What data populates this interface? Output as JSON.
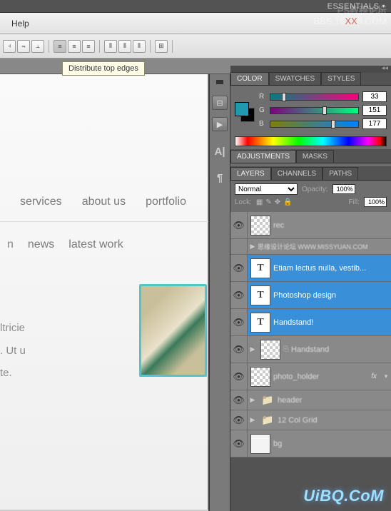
{
  "topbar": {
    "workspace": "ESSENTIALS"
  },
  "watermarks": {
    "w1": "PS教程论坛",
    "w2a": "BBS.16",
    "w2b": "XX",
    "w2c": "8.COM",
    "w3": "UiBQ.CoM"
  },
  "menu": {
    "help": "Help"
  },
  "tooltip": "Distribute top edges",
  "canvas": {
    "nav_main": [
      "services",
      "about us",
      "portfolio"
    ],
    "nav_sub": [
      "n",
      "news",
      "latest work"
    ],
    "hero_lines": [
      "ltricie",
      ". Ut u",
      "te."
    ]
  },
  "color": {
    "tabs": [
      "COLOR",
      "SWATCHES",
      "STYLES"
    ],
    "channels": [
      {
        "label": "R",
        "value": "33",
        "thumb_pct": 13
      },
      {
        "label": "G",
        "value": "151",
        "thumb_pct": 59
      },
      {
        "label": "B",
        "value": "177",
        "thumb_pct": 69
      }
    ]
  },
  "adjustments": {
    "tabs": [
      "ADJUSTMENTS",
      "MASKS"
    ]
  },
  "layers": {
    "tabs": [
      "LAYERS",
      "CHANNELS",
      "PATHS"
    ],
    "blend_mode": "Normal",
    "opacity_label": "Opacity:",
    "opacity": "100%",
    "lock_label": "Lock:",
    "fill_label": "Fill:",
    "fill": "100%",
    "items": [
      {
        "name": "rec",
        "selected": false,
        "type": "checker"
      },
      {
        "name": "思缘设计论坛  WWW.MISSYUAN.COM",
        "selected": false,
        "type": "watermark"
      },
      {
        "name": "Etiam lectus nulla, vestib...",
        "selected": true,
        "type": "text"
      },
      {
        "name": "Photoshop design",
        "selected": true,
        "type": "text"
      },
      {
        "name": "Handstand!",
        "selected": true,
        "type": "text"
      },
      {
        "name": "Handstand",
        "selected": false,
        "type": "smart"
      },
      {
        "name": "photo_holder",
        "selected": false,
        "type": "checker",
        "fx": "fx"
      },
      {
        "name": "header",
        "selected": false,
        "type": "folder"
      },
      {
        "name": "12 Col Grid",
        "selected": false,
        "type": "folder"
      },
      {
        "name": "bg",
        "selected": false,
        "type": "solid"
      }
    ]
  }
}
